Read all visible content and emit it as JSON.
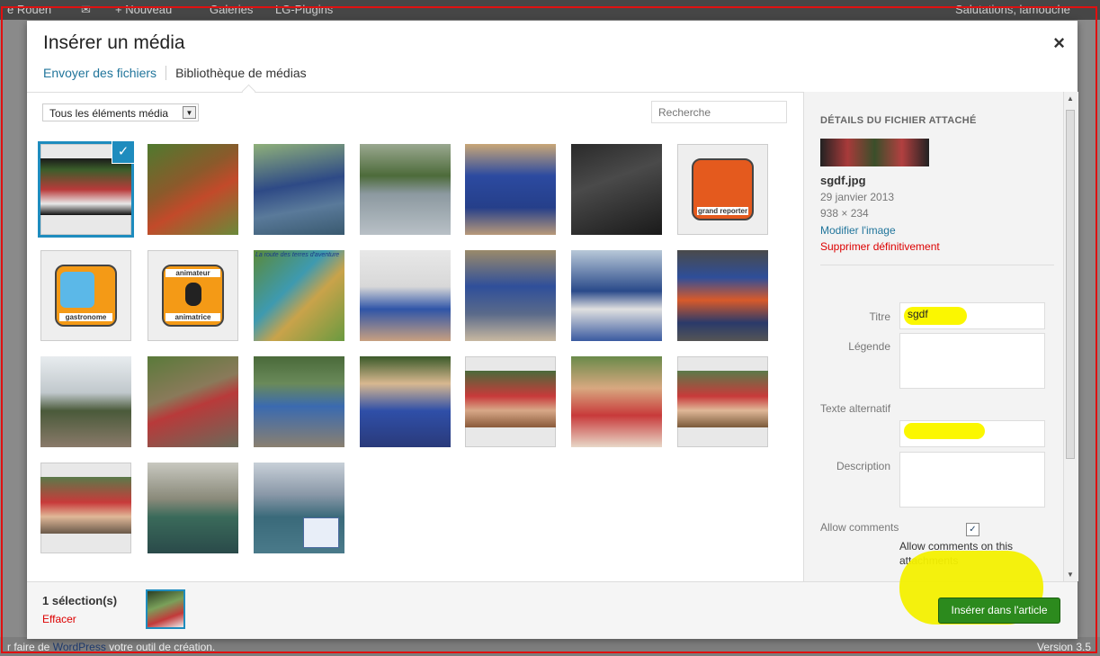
{
  "adminbar": {
    "site": "e Rouen",
    "new": "+ Nouveau",
    "galeries": "Galeries",
    "plugins": "LG-Plugins",
    "greeting": "Salutations, lamouche"
  },
  "footer": {
    "prefix": "r faire de ",
    "wordpress": "WordPress",
    "suffix": " votre outil de création.",
    "version": "Version 3.5"
  },
  "modal": {
    "title": "Insérer un média",
    "close": "×",
    "tabs": [
      "Envoyer des fichiers",
      "Bibliothèque de médias"
    ],
    "filter": {
      "selected": "Tous les éléments média"
    },
    "search": {
      "placeholder": "Recherche"
    }
  },
  "thumbnails": [
    {
      "id": "t1",
      "kind": "sgdf banner"
    },
    {
      "id": "t2",
      "kind": "photo"
    },
    {
      "id": "t3",
      "kind": "photo"
    },
    {
      "id": "t4",
      "kind": "photo"
    },
    {
      "id": "t5",
      "kind": "photo"
    },
    {
      "id": "t6",
      "kind": "photo"
    },
    {
      "id": "t7",
      "kind": "grand reporter icon"
    },
    {
      "id": "t8",
      "kind": "gastronome icon"
    },
    {
      "id": "t9",
      "kind": "animateur icon"
    },
    {
      "id": "t10",
      "kind": "map"
    },
    {
      "id": "t11",
      "kind": "photo"
    },
    {
      "id": "t12",
      "kind": "photo"
    },
    {
      "id": "t13",
      "kind": "photo"
    },
    {
      "id": "t14",
      "kind": "photo"
    },
    {
      "id": "t15",
      "kind": "photo"
    },
    {
      "id": "t16",
      "kind": "photo"
    },
    {
      "id": "t17",
      "kind": "photo"
    },
    {
      "id": "t18",
      "kind": "photo"
    },
    {
      "id": "t19",
      "kind": "photo"
    },
    {
      "id": "t20",
      "kind": "photo"
    },
    {
      "id": "t21",
      "kind": "photo"
    },
    {
      "id": "t22",
      "kind": "photo"
    },
    {
      "id": "t23",
      "kind": "photo"
    },
    {
      "id": "t24",
      "kind": "photo"
    }
  ],
  "thumb_labels": {
    "grand_reporter": "grand reporter",
    "gastronome": "gastronome",
    "animateur": "animateur",
    "animatrice": "animatrice",
    "map_title": "La route des terres d'aventure",
    "check": "✓"
  },
  "details": {
    "heading": "DÉTAILS DU FICHIER ATTACHÉ",
    "filename": "sgdf.jpg",
    "date": "29 janvier 2013",
    "dimensions": "938 × 234",
    "edit_link": "Modifier l'image",
    "delete_link": "Supprimer définitivement",
    "title_label": "Titre",
    "title_value": "sgdf",
    "caption_label": "Légende",
    "alt_label": "Texte alternatif",
    "description_label": "Description",
    "allow_label": "Allow comments",
    "allow_text": "Allow comments on this attachments",
    "allow_checked": "✓"
  },
  "bottom": {
    "count": "1 sélection(s)",
    "clear": "Effacer",
    "insert": "Insérer dans l'article"
  },
  "colors": {
    "accent": "#21759b",
    "select": "#1e8cbe",
    "insert": "#2c8a1d",
    "highlight": "#fbf700",
    "frame": "#e01010"
  }
}
